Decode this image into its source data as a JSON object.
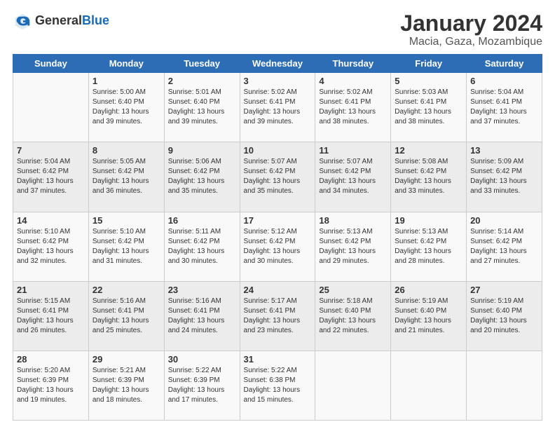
{
  "header": {
    "logo_general": "General",
    "logo_blue": "Blue",
    "month_title": "January 2024",
    "location": "Macia, Gaza, Mozambique"
  },
  "weekdays": [
    "Sunday",
    "Monday",
    "Tuesday",
    "Wednesday",
    "Thursday",
    "Friday",
    "Saturday"
  ],
  "weeks": [
    [
      {
        "day": "",
        "info": ""
      },
      {
        "day": "1",
        "info": "Sunrise: 5:00 AM\nSunset: 6:40 PM\nDaylight: 13 hours\nand 39 minutes."
      },
      {
        "day": "2",
        "info": "Sunrise: 5:01 AM\nSunset: 6:40 PM\nDaylight: 13 hours\nand 39 minutes."
      },
      {
        "day": "3",
        "info": "Sunrise: 5:02 AM\nSunset: 6:41 PM\nDaylight: 13 hours\nand 39 minutes."
      },
      {
        "day": "4",
        "info": "Sunrise: 5:02 AM\nSunset: 6:41 PM\nDaylight: 13 hours\nand 38 minutes."
      },
      {
        "day": "5",
        "info": "Sunrise: 5:03 AM\nSunset: 6:41 PM\nDaylight: 13 hours\nand 38 minutes."
      },
      {
        "day": "6",
        "info": "Sunrise: 5:04 AM\nSunset: 6:41 PM\nDaylight: 13 hours\nand 37 minutes."
      }
    ],
    [
      {
        "day": "7",
        "info": "Sunrise: 5:04 AM\nSunset: 6:42 PM\nDaylight: 13 hours\nand 37 minutes."
      },
      {
        "day": "8",
        "info": "Sunrise: 5:05 AM\nSunset: 6:42 PM\nDaylight: 13 hours\nand 36 minutes."
      },
      {
        "day": "9",
        "info": "Sunrise: 5:06 AM\nSunset: 6:42 PM\nDaylight: 13 hours\nand 35 minutes."
      },
      {
        "day": "10",
        "info": "Sunrise: 5:07 AM\nSunset: 6:42 PM\nDaylight: 13 hours\nand 35 minutes."
      },
      {
        "day": "11",
        "info": "Sunrise: 5:07 AM\nSunset: 6:42 PM\nDaylight: 13 hours\nand 34 minutes."
      },
      {
        "day": "12",
        "info": "Sunrise: 5:08 AM\nSunset: 6:42 PM\nDaylight: 13 hours\nand 33 minutes."
      },
      {
        "day": "13",
        "info": "Sunrise: 5:09 AM\nSunset: 6:42 PM\nDaylight: 13 hours\nand 33 minutes."
      }
    ],
    [
      {
        "day": "14",
        "info": "Sunrise: 5:10 AM\nSunset: 6:42 PM\nDaylight: 13 hours\nand 32 minutes."
      },
      {
        "day": "15",
        "info": "Sunrise: 5:10 AM\nSunset: 6:42 PM\nDaylight: 13 hours\nand 31 minutes."
      },
      {
        "day": "16",
        "info": "Sunrise: 5:11 AM\nSunset: 6:42 PM\nDaylight: 13 hours\nand 30 minutes."
      },
      {
        "day": "17",
        "info": "Sunrise: 5:12 AM\nSunset: 6:42 PM\nDaylight: 13 hours\nand 30 minutes."
      },
      {
        "day": "18",
        "info": "Sunrise: 5:13 AM\nSunset: 6:42 PM\nDaylight: 13 hours\nand 29 minutes."
      },
      {
        "day": "19",
        "info": "Sunrise: 5:13 AM\nSunset: 6:42 PM\nDaylight: 13 hours\nand 28 minutes."
      },
      {
        "day": "20",
        "info": "Sunrise: 5:14 AM\nSunset: 6:42 PM\nDaylight: 13 hours\nand 27 minutes."
      }
    ],
    [
      {
        "day": "21",
        "info": "Sunrise: 5:15 AM\nSunset: 6:41 PM\nDaylight: 13 hours\nand 26 minutes."
      },
      {
        "day": "22",
        "info": "Sunrise: 5:16 AM\nSunset: 6:41 PM\nDaylight: 13 hours\nand 25 minutes."
      },
      {
        "day": "23",
        "info": "Sunrise: 5:16 AM\nSunset: 6:41 PM\nDaylight: 13 hours\nand 24 minutes."
      },
      {
        "day": "24",
        "info": "Sunrise: 5:17 AM\nSunset: 6:41 PM\nDaylight: 13 hours\nand 23 minutes."
      },
      {
        "day": "25",
        "info": "Sunrise: 5:18 AM\nSunset: 6:40 PM\nDaylight: 13 hours\nand 22 minutes."
      },
      {
        "day": "26",
        "info": "Sunrise: 5:19 AM\nSunset: 6:40 PM\nDaylight: 13 hours\nand 21 minutes."
      },
      {
        "day": "27",
        "info": "Sunrise: 5:19 AM\nSunset: 6:40 PM\nDaylight: 13 hours\nand 20 minutes."
      }
    ],
    [
      {
        "day": "28",
        "info": "Sunrise: 5:20 AM\nSunset: 6:39 PM\nDaylight: 13 hours\nand 19 minutes."
      },
      {
        "day": "29",
        "info": "Sunrise: 5:21 AM\nSunset: 6:39 PM\nDaylight: 13 hours\nand 18 minutes."
      },
      {
        "day": "30",
        "info": "Sunrise: 5:22 AM\nSunset: 6:39 PM\nDaylight: 13 hours\nand 17 minutes."
      },
      {
        "day": "31",
        "info": "Sunrise: 5:22 AM\nSunset: 6:38 PM\nDaylight: 13 hours\nand 15 minutes."
      },
      {
        "day": "",
        "info": ""
      },
      {
        "day": "",
        "info": ""
      },
      {
        "day": "",
        "info": ""
      }
    ]
  ]
}
